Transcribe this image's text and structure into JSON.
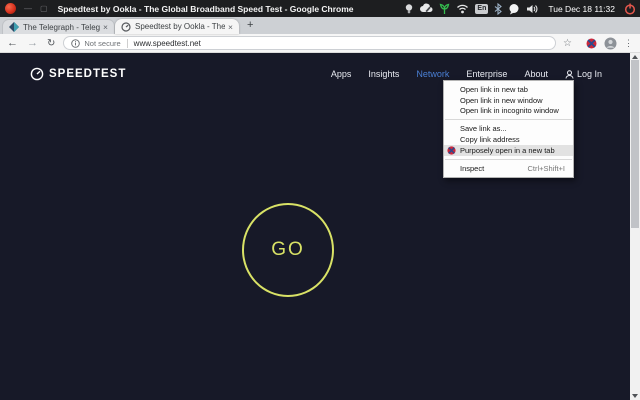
{
  "system_bar": {
    "title": "Speedtest by Ookla - The Global Broadband Speed Test - Google Chrome",
    "clock": "Tue Dec 18 11:32",
    "keyboard_layout": "En"
  },
  "tabs": [
    {
      "title": "The Telegraph - Telegraph Onli"
    },
    {
      "title": "Speedtest by Ookla - The Globa"
    }
  ],
  "toolbar": {
    "security_label": "Not secure",
    "url": "www.speedtest.net"
  },
  "page": {
    "logo_text": "SPEEDTEST",
    "nav": [
      {
        "label": "Apps"
      },
      {
        "label": "Insights"
      },
      {
        "label": "Network"
      },
      {
        "label": "Enterprise"
      },
      {
        "label": "About"
      },
      {
        "label": "Log In"
      }
    ],
    "go_label": "GO"
  },
  "context_menu": {
    "items": [
      {
        "label": "Open link in new tab"
      },
      {
        "label": "Open link in new window"
      },
      {
        "label": "Open link in incognito window"
      },
      {
        "separator": true
      },
      {
        "label": "Save link as..."
      },
      {
        "label": "Copy link address"
      },
      {
        "label": "Purposely open in a new tab",
        "highlighted": true,
        "icon": "purposely-extension-icon"
      },
      {
        "separator": true
      },
      {
        "label": "Inspect",
        "shortcut": "Ctrl+Shift+I"
      }
    ]
  },
  "icons": {
    "back": "←",
    "forward": "→",
    "reload": "↻",
    "star": "☆",
    "overflow_dots": "⋮",
    "tab_close": "×",
    "new_tab": "+",
    "minimize": "—",
    "maximize": "▢"
  },
  "colors": {
    "accent_go": "#d9e266",
    "nav_active_blue": "#4a7fd4",
    "page_background": "#171928",
    "power_red": "#e2574c",
    "extension_red": "#c9283c",
    "extension_blue": "#274b8f"
  }
}
